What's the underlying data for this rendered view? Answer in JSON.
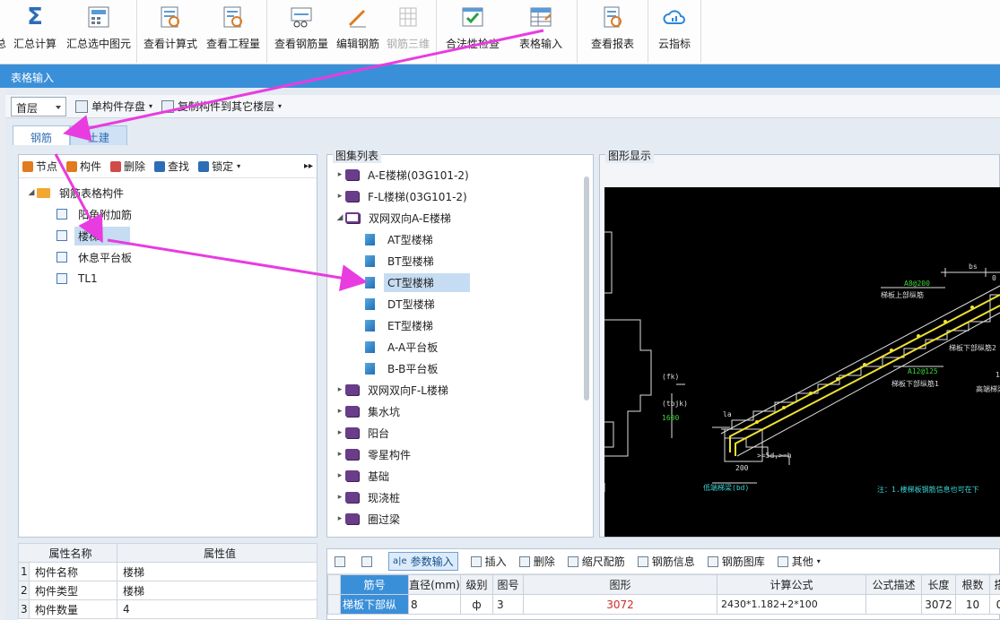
{
  "ribbon": {
    "items": [
      {
        "label": "总",
        "icon": "summary-icon"
      },
      {
        "label": "汇总计算",
        "icon": "sigma-icon"
      },
      {
        "label": "汇总选中图元",
        "icon": "calculator-icon"
      },
      {
        "label": "查看计算式",
        "icon": "view-formula-icon"
      },
      {
        "label": "查看工程量",
        "icon": "view-quantity-icon"
      },
      {
        "label": "查看钢筋量",
        "icon": "view-rebar-icon"
      },
      {
        "label": "编辑钢筋",
        "icon": "edit-rebar-icon"
      },
      {
        "label": "钢筋三维",
        "icon": "rebar-3d-icon"
      },
      {
        "label": "合法性检查",
        "icon": "check-icon"
      },
      {
        "label": "表格输入",
        "icon": "table-input-icon"
      },
      {
        "label": "查看报表",
        "icon": "report-icon"
      },
      {
        "label": "云指标",
        "icon": "cloud-icon"
      }
    ]
  },
  "window": {
    "title": "表格输入"
  },
  "toolbar": {
    "floor": "首层",
    "save_component": "单构件存盘",
    "copy_to_floor": "复制构件到其它楼层"
  },
  "tabs": [
    "钢筋",
    "土建"
  ],
  "left_panel": {
    "tools": [
      "节点",
      "构件",
      "删除",
      "查找",
      "锁定"
    ],
    "root": "钢筋表格构件",
    "items": [
      "阳角附加筋",
      "楼梯",
      "休息平台板",
      "TL1"
    ]
  },
  "props": {
    "headers": [
      "属性名称",
      "属性值"
    ],
    "rows": [
      [
        "1",
        "构件名称",
        "楼梯"
      ],
      [
        "2",
        "构件类型",
        "楼梯"
      ],
      [
        "3",
        "构件数量",
        "4"
      ]
    ]
  },
  "atlas": {
    "title": "图集列表",
    "items": [
      {
        "label": "A-E楼梯(03G101-2)",
        "level": 0,
        "kind": "book"
      },
      {
        "label": "F-L楼梯(03G101-2)",
        "level": 0,
        "kind": "book"
      },
      {
        "label": "双网双向A-E楼梯",
        "level": 0,
        "kind": "open"
      },
      {
        "label": "AT型楼梯",
        "level": 1,
        "kind": "doc"
      },
      {
        "label": "BT型楼梯",
        "level": 1,
        "kind": "doc"
      },
      {
        "label": "CT型楼梯",
        "level": 1,
        "kind": "doc"
      },
      {
        "label": "DT型楼梯",
        "level": 1,
        "kind": "doc"
      },
      {
        "label": "ET型楼梯",
        "level": 1,
        "kind": "doc"
      },
      {
        "label": "A-A平台板",
        "level": 1,
        "kind": "doc"
      },
      {
        "label": "B-B平台板",
        "level": 1,
        "kind": "doc"
      },
      {
        "label": "双网双向F-L楼梯",
        "level": 0,
        "kind": "book"
      },
      {
        "label": "集水坑",
        "level": 0,
        "kind": "book"
      },
      {
        "label": "阳台",
        "level": 0,
        "kind": "book"
      },
      {
        "label": "零星构件",
        "level": 0,
        "kind": "book"
      },
      {
        "label": "基础",
        "level": 0,
        "kind": "book"
      },
      {
        "label": "现浇桩",
        "level": 0,
        "kind": "book"
      },
      {
        "label": "圈过梁",
        "level": 0,
        "kind": "book"
      }
    ]
  },
  "graphic": {
    "title": "图形显示",
    "labels": {
      "a": "A8@200",
      "b": "梯板上部纵筋",
      "c": "A12@125",
      "d": "梯板下部纵筋1",
      "e": "梯板下部纵筋2",
      "f": "(fk)",
      "g": "(tbjk)",
      "h": "1600",
      "i": "la",
      "j": ">=5d,>=h",
      "k": "200",
      "l": "低端梯梁(bd)",
      "m": "bs",
      "n": "高端梯梁",
      "o": "注：1.楼梯板钢筋信息也可在下",
      "p": "1",
      "q": "0"
    }
  },
  "rebar_toolbar": [
    "参数输入",
    "插入",
    "删除",
    "缩尺配筋",
    "钢筋信息",
    "钢筋图库",
    "其他"
  ],
  "grid": {
    "headers": [
      "筋号",
      "直径(mm)",
      "级别",
      "图号",
      "图形",
      "计算公式",
      "公式描述",
      "长度",
      "根数",
      "搭"
    ],
    "row": [
      "梯板下部纵",
      "8",
      "ф",
      "3",
      "3072",
      "2430*1.182+2*100",
      "",
      "3072",
      "10",
      "0"
    ]
  }
}
